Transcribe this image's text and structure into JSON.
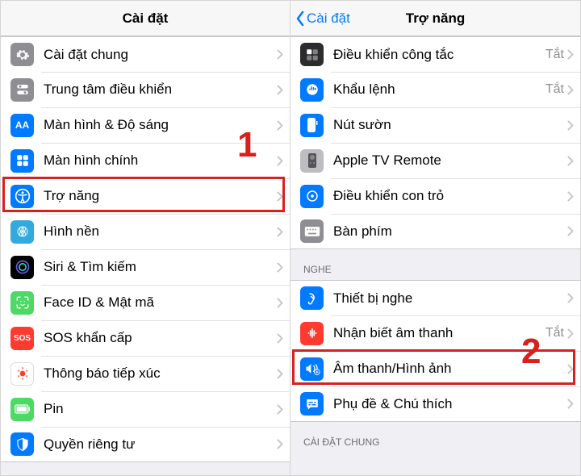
{
  "left": {
    "title": "Cài đặt",
    "rows": [
      {
        "icon": "gear-icon",
        "bg": "bg-gray",
        "label": "Cài đặt chung"
      },
      {
        "icon": "control-center-icon",
        "bg": "bg-gray",
        "label": "Trung tâm điều khiển"
      },
      {
        "icon": "display-icon",
        "bg": "bg-blue",
        "label": "Màn hình & Độ sáng"
      },
      {
        "icon": "home-screen-icon",
        "bg": "bg-blue",
        "label": "Màn hình chính"
      },
      {
        "icon": "accessibility-icon",
        "bg": "bg-blue",
        "label": "Trợ năng"
      },
      {
        "icon": "wallpaper-icon",
        "bg": "bg-teal",
        "label": "Hình nền"
      },
      {
        "icon": "siri-icon",
        "bg": "bg-black",
        "label": "Siri & Tìm kiếm"
      },
      {
        "icon": "faceid-icon",
        "bg": "bg-green",
        "label": "Face ID & Mật mã"
      },
      {
        "icon": "sos-icon",
        "bg": "bg-redsos",
        "label": "SOS khẩn cấp"
      },
      {
        "icon": "exposure-icon",
        "bg": "bg-white",
        "label": "Thông báo tiếp xúc"
      },
      {
        "icon": "battery-icon",
        "bg": "bg-green",
        "label": "Pin"
      },
      {
        "icon": "privacy-icon",
        "bg": "bg-blue",
        "label": "Quyền riêng tư"
      }
    ],
    "highlight_row_index": 4,
    "step_number": "1"
  },
  "right": {
    "back_label": "Cài đặt",
    "title": "Trợ năng",
    "group1": [
      {
        "icon": "switch-control-icon",
        "bg": "bg-dark",
        "label": "Điều khiển công tắc",
        "value": "Tắt"
      },
      {
        "icon": "voice-control-icon",
        "bg": "bg-blue",
        "label": "Khẩu lệnh",
        "value": "Tắt"
      },
      {
        "icon": "side-button-icon",
        "bg": "bg-blue",
        "label": "Nút sườn"
      },
      {
        "icon": "appletv-remote-icon",
        "bg": "bg-lgray",
        "label": "Apple TV Remote"
      },
      {
        "icon": "pointer-icon",
        "bg": "bg-blue",
        "label": "Điều khiển con trỏ"
      },
      {
        "icon": "keyboard-icon",
        "bg": "bg-gray",
        "label": "Bàn phím"
      }
    ],
    "section2_title": "NGHE",
    "group2": [
      {
        "icon": "hearing-icon",
        "bg": "bg-blue",
        "label": "Thiết bị nghe"
      },
      {
        "icon": "sound-recognition-icon",
        "bg": "bg-redicon",
        "label": "Nhận biết âm thanh",
        "value": "Tắt"
      },
      {
        "icon": "audio-visual-icon",
        "bg": "bg-blue",
        "label": "Âm thanh/Hình ảnh"
      },
      {
        "icon": "subtitles-icon",
        "bg": "bg-blue",
        "label": "Phụ đề & Chú thích"
      }
    ],
    "section3_title": "CÀI ĐẶT CHUNG",
    "highlight_row_index": 2,
    "step_number": "2"
  }
}
